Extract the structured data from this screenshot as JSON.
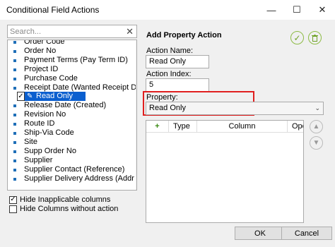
{
  "window": {
    "title": "Conditional Field Actions",
    "minimize_glyph": "—",
    "maximize_glyph": "☐",
    "close_glyph": "✕"
  },
  "search": {
    "placeholder": "Search...",
    "value": "",
    "clear_glyph": "✕"
  },
  "fields": [
    "Order Code",
    "Order No",
    "Payment Terms (Pay Term ID)",
    "Project ID",
    "Purchase Code",
    "Receipt Date (Wanted Receipt Date)",
    "Read Only",
    "Release Date (Created)",
    "Revision No",
    "Route ID",
    "Ship-Via Code",
    "Site",
    "Supp Order No",
    "Supplier",
    "Supplier Contact (Reference)",
    "Supplier Delivery Address (Addr ID)"
  ],
  "selected_action": {
    "check_glyph": "✓",
    "icon": "pencil-icon",
    "label": "Read Only"
  },
  "options": {
    "hide_inapplicable": {
      "label": "Hide Inapplicable columns",
      "checked": true
    },
    "hide_without_action": {
      "label": "Hide Columns without action",
      "checked": false
    }
  },
  "panel": {
    "title": "Add Property Action",
    "action_name_label": "Action Name:",
    "action_name_value": "Read Only",
    "action_index_label": "Action Index:",
    "action_index_value": "5",
    "property_label": "Property:",
    "property_value": "Read Only",
    "accept_icon": "check-circle-icon",
    "delete_icon": "trash-icon"
  },
  "grid": {
    "add_glyph": "+",
    "columns": [
      "Type",
      "Column",
      "Ope"
    ]
  },
  "buttons": {
    "ok": "OK",
    "cancel": "Cancel"
  },
  "colors": {
    "selection": "#0b5fcf",
    "highlight_border": "#e01f1f",
    "accent_green": "#6fa228"
  }
}
